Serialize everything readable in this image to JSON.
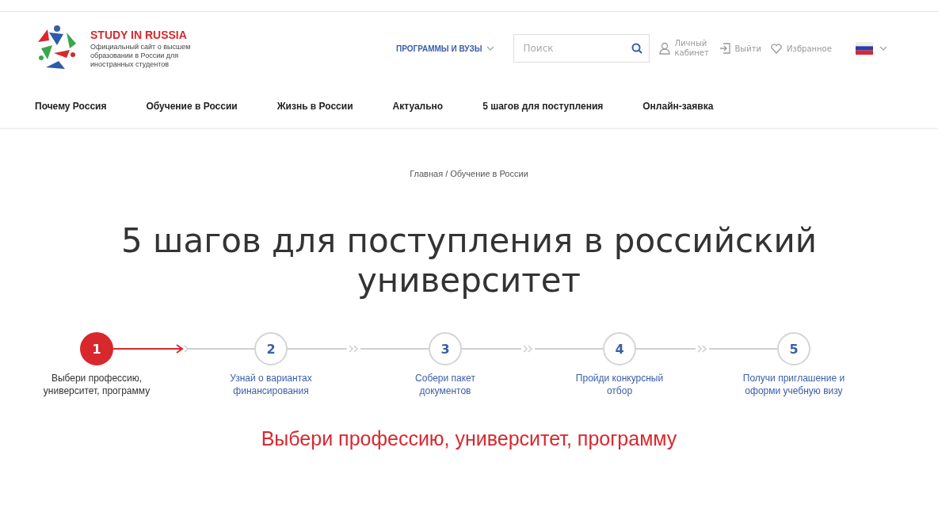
{
  "logo": {
    "title": "STUDY IN RUSSIA",
    "subtitle": "Официальный сайт о высшем образовании в России для иностранных студентов"
  },
  "header": {
    "programs_menu": "ПРОГРАММЫ И ВУЗЫ",
    "search": {
      "placeholder": "Поиск"
    },
    "account": "Личный кабинет",
    "logout": "Выйти",
    "favorites": "Избранное"
  },
  "nav": [
    "Почему Россия",
    "Обучение в России",
    "Жизнь в России",
    "Актуально",
    "5 шагов для поступления",
    "Онлайн-заявка"
  ],
  "breadcrumb": "Главная / Обучение в России",
  "title": "5 шагов для поступления в российский университет",
  "steps": [
    {
      "number": "1",
      "label": "Выбери профессию, университет, программу",
      "selected": true
    },
    {
      "number": "2",
      "label": "Узнай о вариантах финансирования",
      "selected": false
    },
    {
      "number": "3",
      "label": "Собери пакет документов",
      "selected": false
    },
    {
      "number": "4",
      "label": "Пройди конкурсный отбор",
      "selected": false
    },
    {
      "number": "5",
      "label": "Получи приглашение и оформи учебную визу",
      "selected": false
    }
  ],
  "section_heading": "Выбери профессию, университет, программу"
}
